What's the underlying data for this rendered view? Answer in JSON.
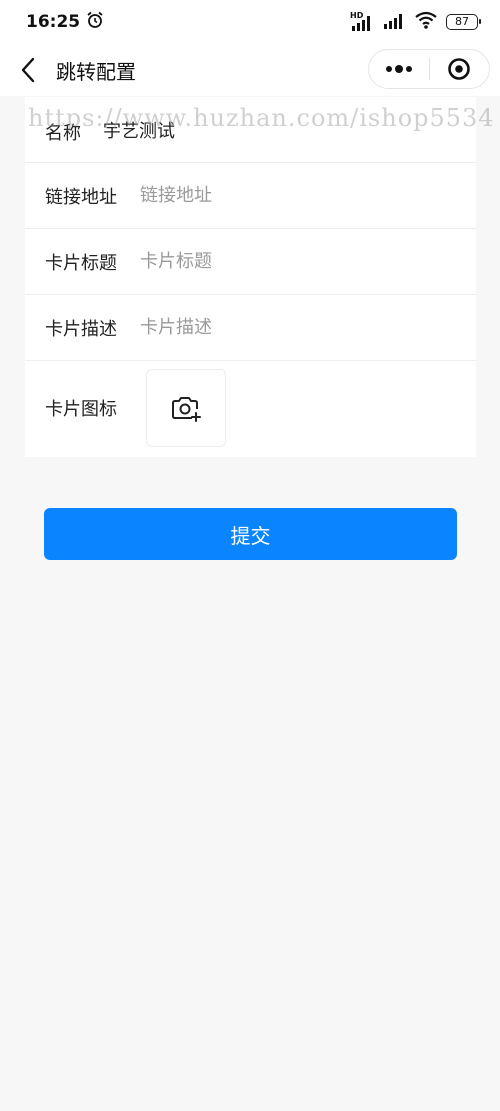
{
  "status_bar": {
    "time": "16:25",
    "network_label": "HD",
    "battery_level": "87"
  },
  "nav": {
    "title": "跳转配置"
  },
  "form": {
    "name": {
      "label": "名称",
      "value": "宇艺测试"
    },
    "link": {
      "label": "链接地址",
      "placeholder": "链接地址"
    },
    "card_title": {
      "label": "卡片标题",
      "placeholder": "卡片标题"
    },
    "card_desc": {
      "label": "卡片描述",
      "placeholder": "卡片描述"
    },
    "card_icon": {
      "label": "卡片图标"
    }
  },
  "submit_label": "提交",
  "watermark": "https://www.huzhan.com/ishop5534",
  "colors": {
    "primary": "#0a84ff",
    "page_background": "#f7f7f7"
  }
}
